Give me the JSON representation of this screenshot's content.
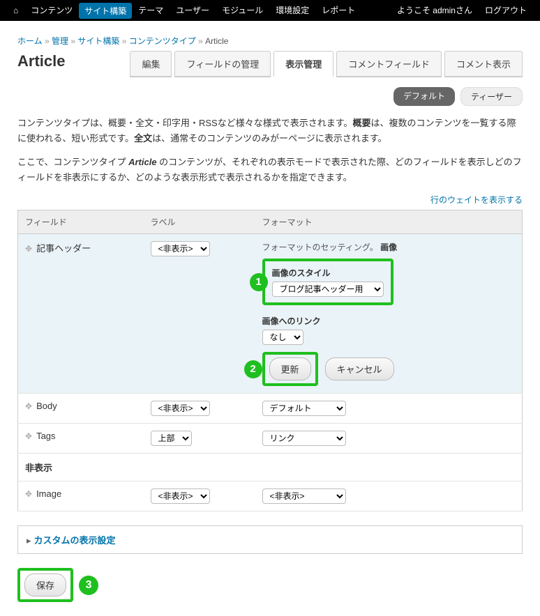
{
  "topnav": {
    "items": [
      "コンテンツ",
      "サイト構築",
      "テーマ",
      "ユーザー",
      "モジュール",
      "環境設定",
      "レポート"
    ],
    "active_index": 1,
    "welcome": "ようこそ adminさん",
    "logout": "ログアウト"
  },
  "breadcrumbs": {
    "items": [
      "ホーム",
      "管理",
      "サイト構築",
      "コンテンツタイプ",
      "Article"
    ],
    "link_last": false
  },
  "page_title": "Article",
  "tabs": {
    "items": [
      "編集",
      "フィールドの管理",
      "表示管理",
      "コメントフィールド",
      "コメント表示"
    ],
    "active_index": 2
  },
  "subtabs": {
    "items": [
      "デフォルト",
      "ティーザー"
    ],
    "active_index": 0
  },
  "help": {
    "p1_pre": "コンテンツタイプは、概要・全文・印字用・RSSなど様々な様式で表示されます。",
    "p1_b1": "概要",
    "p1_mid": "は、複数のコンテンツを一覧する際に使われる、短い形式です。",
    "p1_b2": "全文",
    "p1_post": "は、通常そのコンテンツのみがーページに表示されます。",
    "p2_pre": "ここで、コンテンツタイプ ",
    "p2_em": "Article",
    "p2_post": " のコンテンツが、それぞれの表示モードで表示された際、どのフィールドを表示しどのフィールドを非表示にするか、どのような表示形式で表示されるかを指定できます。"
  },
  "rightlink": "行のウェイトを表示する",
  "table": {
    "headers": {
      "field": "フィールド",
      "label": "ラベル",
      "format": "フォーマット"
    },
    "rows": [
      {
        "name": "記事ヘッダー",
        "label_select": "<非表示>",
        "highlight": true,
        "settings": {
          "setting_text": "フォーマットのセッティング。",
          "setting_bold": "画像",
          "style_label": "画像のスタイル",
          "style_value": "ブログ記事ヘッダー用",
          "link_label": "画像へのリンク",
          "link_value": "なし",
          "update_btn": "更新",
          "cancel_btn": "キャンセル"
        }
      },
      {
        "name": "Body",
        "label_select": "<非表示>",
        "format_select": "デフォルト"
      },
      {
        "name": "Tags",
        "label_select": "上部",
        "format_select": "リンク"
      },
      {
        "section": "非表示"
      },
      {
        "name": "Image",
        "label_select": "<非表示>",
        "format_select": "<非表示>"
      }
    ]
  },
  "collapsible": {
    "label": "カスタムの表示設定"
  },
  "save_btn": "保存",
  "badges": {
    "one": "1",
    "two": "2",
    "three": "3"
  }
}
